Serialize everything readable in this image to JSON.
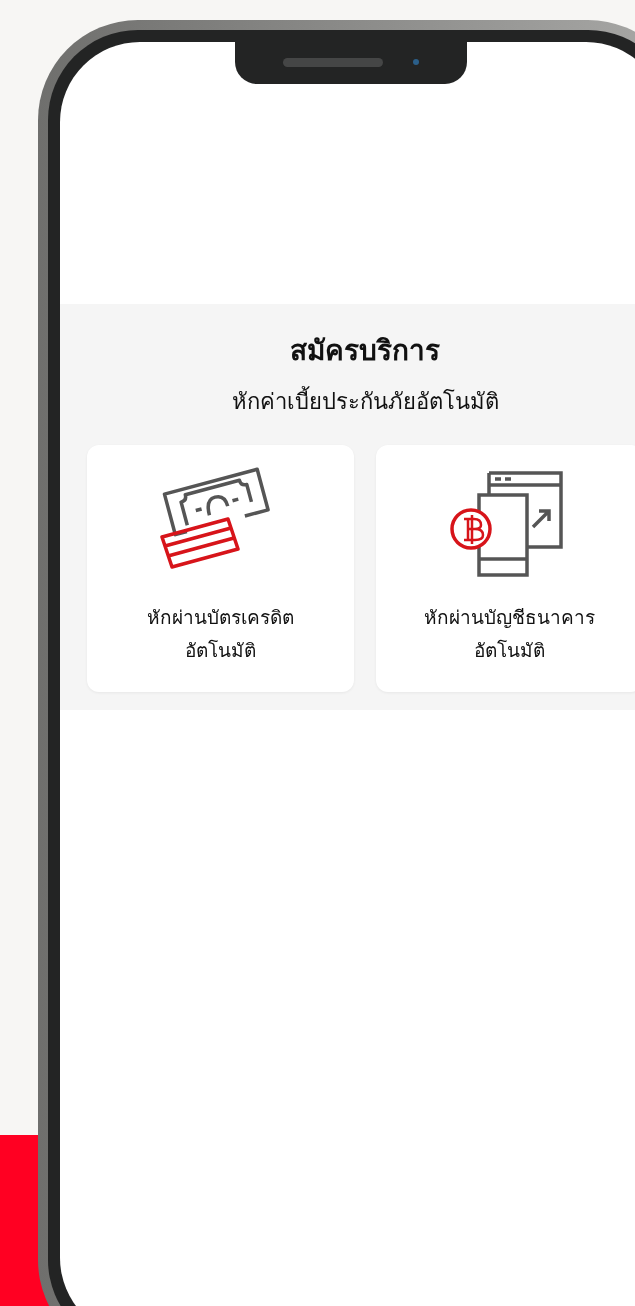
{
  "header": {
    "title": "สมัครบริการ",
    "subtitle": "หักค่าเบี้ยประกันภัยอัตโนมัติ"
  },
  "options": [
    {
      "kind": "credit_card",
      "label": "หักผ่านบัตรเครดิต\nอัตโนมัติ"
    },
    {
      "kind": "bank_account",
      "label": "หักผ่านบัญชีธนาคาร\nอัตโนมัติ"
    }
  ]
}
